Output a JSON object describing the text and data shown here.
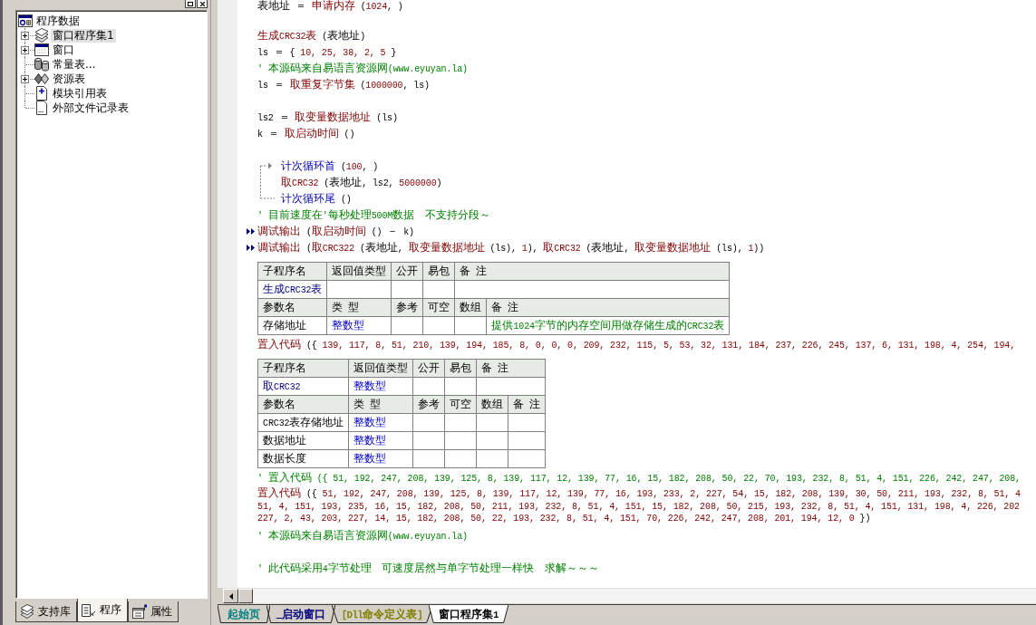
{
  "explorer": {
    "tree": {
      "label": "程序数据",
      "children": [
        {
          "label": "窗口程序集1",
          "kind": "assembly",
          "expandable": true,
          "selected": true
        },
        {
          "label": "窗口",
          "kind": "window",
          "expandable": true,
          "selected": false
        },
        {
          "label": "常量表...",
          "kind": "constants",
          "expandable": false,
          "selected": false
        },
        {
          "label": "资源表",
          "kind": "resources",
          "expandable": true,
          "selected": false
        },
        {
          "label": "模块引用表",
          "kind": "modules",
          "expandable": false,
          "selected": false
        },
        {
          "label": "外部文件记录表",
          "kind": "files",
          "expandable": false,
          "selected": false
        }
      ]
    },
    "tabs": [
      {
        "label": "支持库",
        "kind": "library",
        "selected": false
      },
      {
        "label": "程序",
        "kind": "program",
        "selected": true
      },
      {
        "label": "属性",
        "kind": "properties",
        "selected": false
      }
    ]
  },
  "editor": {
    "lines": [
      {
        "kind": "code",
        "segments": [
          {
            "text": "表地址 ＝ ",
            "kind": "plain"
          },
          {
            "text": "申请内存",
            "kind": "call"
          },
          {
            "text": " (",
            "kind": "plain"
          },
          {
            "text": "1024",
            "kind": "number"
          },
          {
            "text": ", )",
            "kind": "plain"
          }
        ]
      },
      {
        "kind": "blank"
      },
      {
        "kind": "code",
        "segments": [
          {
            "text": "生成CRC32表",
            "kind": "call"
          },
          {
            "text": " (表地址)",
            "kind": "plain"
          }
        ]
      },
      {
        "kind": "code",
        "segments": [
          {
            "text": "ls ＝ { ",
            "kind": "plain"
          },
          {
            "text": "10, 25, 38, 2, 5",
            "kind": "number"
          },
          {
            "text": " }",
            "kind": "plain"
          }
        ]
      },
      {
        "kind": "comment",
        "text": "' 本源码来自易语言资源网(www.eyuyan.la)"
      },
      {
        "kind": "code",
        "segments": [
          {
            "text": "ls ＝ ",
            "kind": "plain"
          },
          {
            "text": "取重复字节集",
            "kind": "call"
          },
          {
            "text": " (",
            "kind": "plain"
          },
          {
            "text": "1000000",
            "kind": "number"
          },
          {
            "text": ", ls)",
            "kind": "plain"
          }
        ]
      },
      {
        "kind": "blank"
      },
      {
        "kind": "code",
        "segments": [
          {
            "text": "ls2 ＝ ",
            "kind": "plain"
          },
          {
            "text": "取变量数据地址",
            "kind": "call"
          },
          {
            "text": " (ls)",
            "kind": "plain"
          }
        ]
      },
      {
        "kind": "code",
        "segments": [
          {
            "text": "k ＝ ",
            "kind": "plain"
          },
          {
            "text": "取启动时间",
            "kind": "call"
          },
          {
            "text": " ()",
            "kind": "plain"
          }
        ]
      },
      {
        "kind": "blank"
      },
      {
        "kind": "loop",
        "head": {
          "segments": [
            {
              "text": "计次循环首",
              "kind": "flow"
            },
            {
              "text": " (",
              "kind": "plain"
            },
            {
              "text": "100",
              "kind": "number"
            },
            {
              "text": ", )",
              "kind": "plain"
            }
          ]
        },
        "body": [
          {
            "segments": [
              {
                "text": "取CRC32",
                "kind": "call"
              },
              {
                "text": " (表地址, ls2, ",
                "kind": "plain"
              },
              {
                "text": "5000000",
                "kind": "number"
              },
              {
                "text": ")",
                "kind": "plain"
              }
            ]
          }
        ],
        "tail": {
          "segments": [
            {
              "text": "计次循环尾",
              "kind": "flow"
            },
            {
              "text": " ()",
              "kind": "plain"
            }
          ]
        }
      },
      {
        "kind": "comment",
        "text": "' 目前速度在'每秒处理500M数据  不支持分段～"
      },
      {
        "kind": "debug",
        "segments": [
          {
            "text": "调试输出",
            "kind": "call"
          },
          {
            "text": " (",
            "kind": "plain"
          },
          {
            "text": "取启动时间",
            "kind": "call"
          },
          {
            "text": " () － k)",
            "kind": "plain"
          }
        ]
      },
      {
        "kind": "debug",
        "segments": [
          {
            "text": "调试输出",
            "kind": "call"
          },
          {
            "text": " (",
            "kind": "plain"
          },
          {
            "text": "取CRC322",
            "kind": "call"
          },
          {
            "text": " (表地址, ",
            "kind": "plain"
          },
          {
            "text": "取变量数据地址",
            "kind": "call"
          },
          {
            "text": " (ls), ",
            "kind": "plain"
          },
          {
            "text": "1",
            "kind": "number"
          },
          {
            "text": "), ",
            "kind": "plain"
          },
          {
            "text": "取CRC32",
            "kind": "call"
          },
          {
            "text": " (表地址, ",
            "kind": "plain"
          },
          {
            "text": "取变量数据地址",
            "kind": "call"
          },
          {
            "text": " (ls), ",
            "kind": "plain"
          },
          {
            "text": "1",
            "kind": "number"
          },
          {
            "text": "))",
            "kind": "plain"
          }
        ]
      },
      {
        "kind": "table",
        "header": [
          "子程序名",
          "返回值类型",
          "公开",
          "易包",
          "备 注"
        ],
        "name": "生成CRC32表",
        "param_header": [
          "参数名",
          "类 型",
          "参考",
          "可空",
          "数组",
          "备 注"
        ],
        "params": [
          {
            "name": "存储地址",
            "type": "整数型",
            "note": "提供1024字节的内存空间用做存储生成的CRC32表"
          }
        ]
      },
      {
        "kind": "code",
        "segments": [
          {
            "text": "置入代码",
            "kind": "call"
          },
          {
            "text": " ({ ",
            "kind": "plain"
          },
          {
            "text": "139, 117, 8, 51, 210, 139, 194, 185, 8, 0, 0, 0, 209, 232, 115, 5, 53, 32, 131, 184, 237, 226, 245, 137, 6, 131, 198, 4, 254, 194,",
            "kind": "number"
          }
        ]
      },
      {
        "kind": "table",
        "header": [
          "子程序名",
          "返回值类型",
          "公开",
          "易包",
          "备 注"
        ],
        "name": "取CRC32",
        "return_type": "整数型",
        "param_header": [
          "参数名",
          "类 型",
          "参考",
          "可空",
          "数组",
          "备 注"
        ],
        "params": [
          {
            "name": "CRC32表存储地址",
            "type": "整数型"
          },
          {
            "name": "数据地址",
            "type": "整数型"
          },
          {
            "name": "数据长度",
            "type": "整数型"
          }
        ]
      },
      {
        "kind": "comment",
        "text": "' 置入代码 ({ 51, 192, 247, 208, 139, 125, 8, 139, 117, 12, 139, 77, 16, 15, 182, 208, 50, 22, 70, 193, 232, 8, 51, 4, 151, 226, 242, 247, 208,"
      },
      {
        "kind": "wrapped",
        "rows": [
          {
            "segments": [
              {
                "text": "置入代码",
                "kind": "call"
              },
              {
                "text": " ({ ",
                "kind": "plain"
              },
              {
                "text": "51, 192, 247, 208, 139, 125, 8, 139, 117, 12, 139, 77, 16, 193, 233, 2, 227, 54, 15, 182, 208, 139, 30, 50, 211, 193, 232, 8, 51, 4",
                "kind": "number"
              }
            ]
          },
          {
            "segments": [
              {
                "text": "51, 4, 151, 193, 235, 16, 15, 182, 208, 50, 211, 193, 232, 8, 51, 4, 151, 15, 182, 208, 50, 215, 193, 232, 8, 51, 4, 151, 131, 198, 4, 226, 202",
                "kind": "number"
              }
            ]
          },
          {
            "segments": [
              {
                "text": "227, 2, 43, 203, 227, 14, 15, 182, 208, 50, 22, 193, 232, 8, 51, 4, 151, 70, 226, 242, 247, 208, 201, 194, 12, 0",
                "kind": "number"
              },
              {
                "text": " })",
                "kind": "plain"
              }
            ]
          }
        ]
      },
      {
        "kind": "comment",
        "text": "' 本源码来自易语言资源网(www.eyuyan.la)"
      },
      {
        "kind": "blank"
      },
      {
        "kind": "comment",
        "text": "' 此代码采用4字节处理  可速度居然与单字节处理一样快  求解～～～"
      }
    ],
    "tabs": [
      {
        "label": "起始页",
        "color": "#008080",
        "selected": false
      },
      {
        "label": "_启动窗口",
        "color": "#000080",
        "selected": false
      },
      {
        "label": "[Dll命令定义表]",
        "color": "#808000",
        "selected": false
      },
      {
        "label": "窗口程序集1",
        "color": "#000000",
        "selected": true
      }
    ]
  }
}
